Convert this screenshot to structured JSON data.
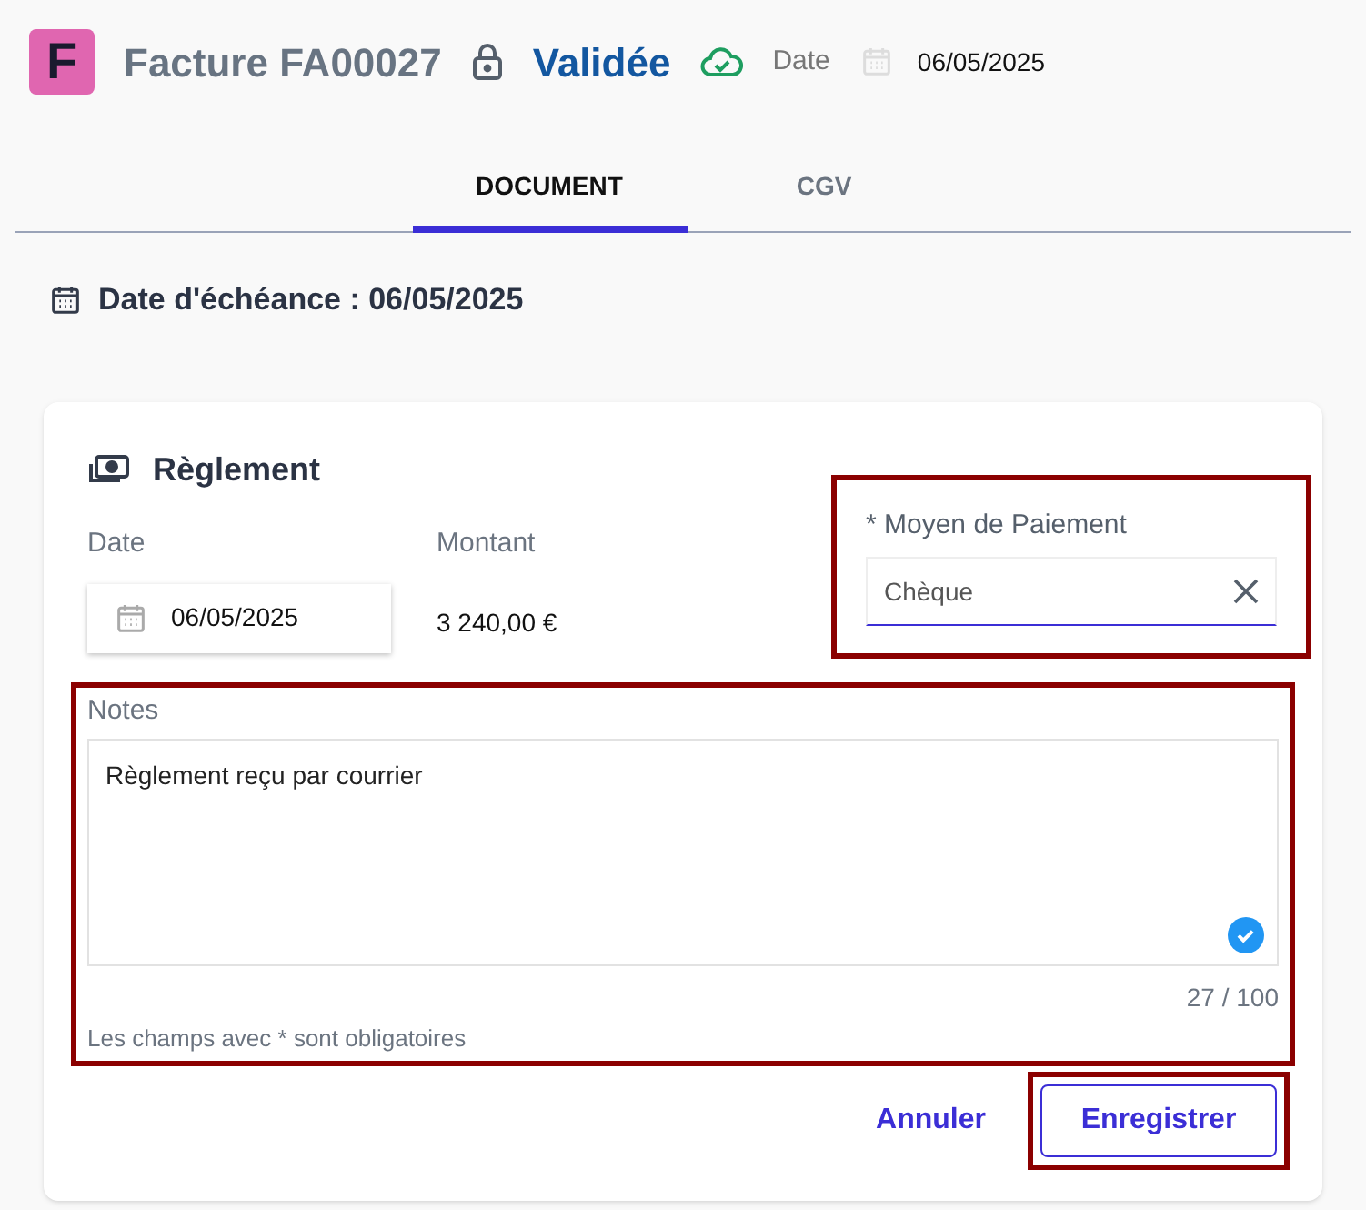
{
  "header": {
    "logo_letter": "F",
    "title": "Facture FA00027",
    "locked": true,
    "status": "Validée",
    "synced": true,
    "date_label": "Date",
    "date": "06/05/2025"
  },
  "tabs": [
    {
      "label": "DOCUMENT",
      "selected": true
    },
    {
      "label": "CGV",
      "selected": false
    }
  ],
  "due_date": "Date d'échéance : 06/05/2025",
  "payment": {
    "title": "Règlement",
    "date": {
      "label": "Date",
      "value": "06/05/2025"
    },
    "amount": {
      "label": "Montant",
      "value": "3 240,00 €"
    },
    "method": {
      "label": "* Moyen de Paiement",
      "value": "Chèque",
      "highlighted": true
    },
    "notes": {
      "label": "Notes",
      "value": "Règlement reçu par courrier",
      "counter": "27 / 100",
      "hint": "Les champs avec * sont obligatoires",
      "highlighted": true
    },
    "buttons": [
      {
        "label": "Annuler",
        "kind": "text",
        "highlighted": false
      },
      {
        "label": "Enregistrer",
        "kind": "outlined",
        "highlighted": true
      }
    ]
  }
}
